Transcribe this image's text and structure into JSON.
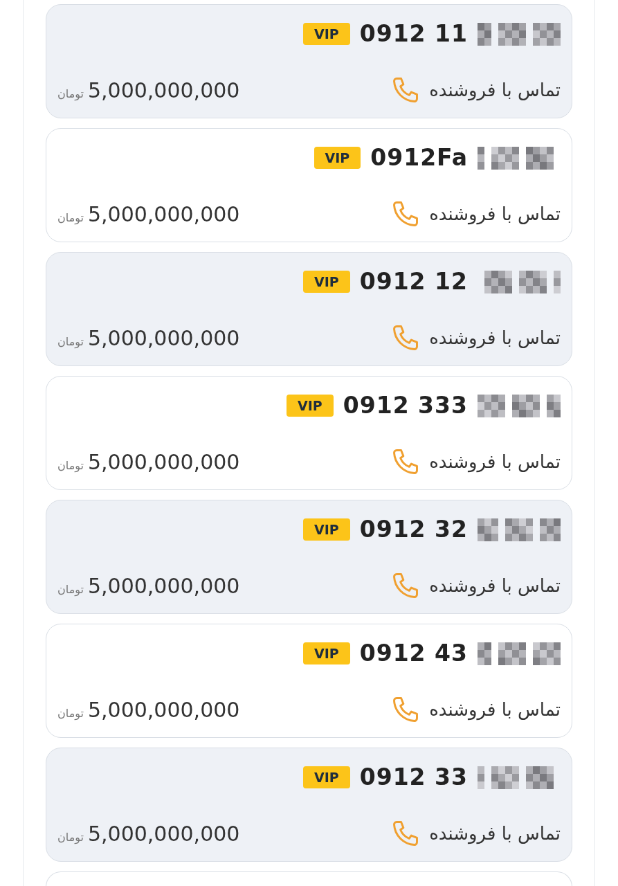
{
  "listings": [
    {
      "number": "0912 11",
      "badge": "VIP",
      "highlighted": true,
      "call_label": "تماس با فروشنده",
      "price": "5,000,000,000",
      "currency": "تومان"
    },
    {
      "number": "0912Fa",
      "badge": "VIP",
      "highlighted": false,
      "call_label": "تماس با فروشنده",
      "price": "5,000,000,000",
      "currency": "تومان"
    },
    {
      "number": "0912 12",
      "badge": "VIP",
      "highlighted": true,
      "call_label": "تماس با فروشنده",
      "price": "5,000,000,000",
      "currency": "تومان"
    },
    {
      "number": "0912 333",
      "badge": "VIP",
      "highlighted": false,
      "call_label": "تماس با فروشنده",
      "price": "5,000,000,000",
      "currency": "تومان"
    },
    {
      "number": "0912 32",
      "badge": "VIP",
      "highlighted": true,
      "call_label": "تماس با فروشنده",
      "price": "5,000,000,000",
      "currency": "تومان"
    },
    {
      "number": "0912 43",
      "badge": "VIP",
      "highlighted": false,
      "call_label": "تماس با فروشنده",
      "price": "5,000,000,000",
      "currency": "تومان"
    },
    {
      "number": "0912 33",
      "badge": "VIP",
      "highlighted": true,
      "call_label": "تماس با فروشنده",
      "price": "5,000,000,000",
      "currency": "تومان"
    }
  ]
}
